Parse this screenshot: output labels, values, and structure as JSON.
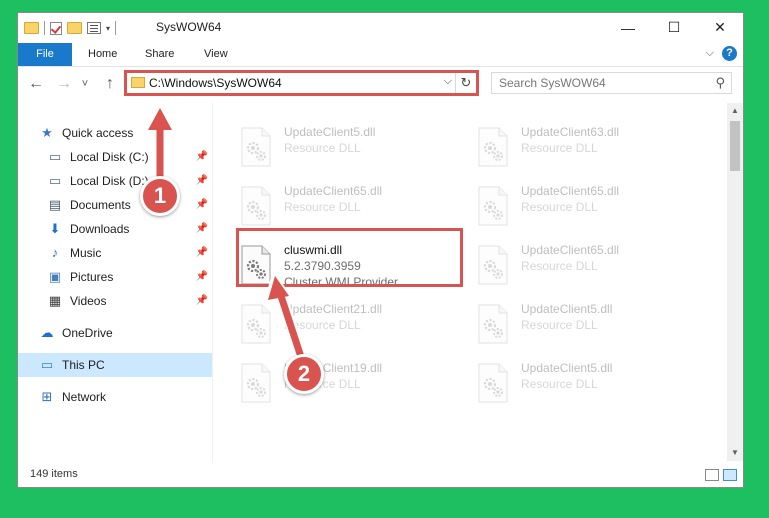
{
  "window": {
    "title": "SysWOW64",
    "controls": {
      "minimize": "—",
      "maximize": "☐",
      "close": "✕"
    }
  },
  "ribbon": {
    "tabs": [
      "File",
      "Home",
      "Share",
      "View"
    ],
    "expand_glyph": "⌵",
    "help_glyph": "?"
  },
  "nav": {
    "back_glyph": "←",
    "forward_glyph": "→",
    "recent_glyph": "˅",
    "up_glyph": "↑",
    "address": "C:\\Windows\\SysWOW64",
    "address_dropdown_glyph": "⌵",
    "refresh_glyph": "↻",
    "search_placeholder": "Search SysWOW64",
    "search_glyph": "⚲"
  },
  "sidebar": {
    "items": [
      {
        "label": "Quick access",
        "icon": "star-icon",
        "glyph": "★",
        "color": "#3a78c9",
        "pinned": false
      },
      {
        "label": "Local Disk (C:)",
        "icon": "drive-icon",
        "glyph": "▭",
        "color": "#5a6e80",
        "pinned": true
      },
      {
        "label": "Local Disk (D:)",
        "icon": "drive-icon",
        "glyph": "▭",
        "color": "#5a6e80",
        "pinned": true
      },
      {
        "label": "Documents",
        "icon": "document-icon",
        "glyph": "▤",
        "color": "#4a5a6a",
        "pinned": true
      },
      {
        "label": "Downloads",
        "icon": "download-icon",
        "glyph": "⬇",
        "color": "#1f6fcf",
        "pinned": true
      },
      {
        "label": "Music",
        "icon": "music-icon",
        "glyph": "♪",
        "color": "#2e6fd0",
        "pinned": true
      },
      {
        "label": "Pictures",
        "icon": "pictures-icon",
        "glyph": "▣",
        "color": "#4a7fb8",
        "pinned": true
      },
      {
        "label": "Videos",
        "icon": "video-icon",
        "glyph": "▦",
        "color": "#3a3a3a",
        "pinned": true
      },
      {
        "label": "OneDrive",
        "icon": "cloud-icon",
        "glyph": "☁",
        "color": "#1d6fd1",
        "pinned": false
      },
      {
        "label": "This PC",
        "icon": "computer-icon",
        "glyph": "▭",
        "color": "#2f88d8",
        "pinned": false,
        "selected": true
      },
      {
        "label": "Network",
        "icon": "network-icon",
        "glyph": "⊞",
        "color": "#2f6fb8",
        "pinned": false
      }
    ],
    "pin_glyph": "📌"
  },
  "files": [
    {
      "name": "UpdateClient5.dll",
      "sub1": "Resource DLL",
      "faded": true
    },
    {
      "name": "UpdateClient63.dll",
      "sub1": "Resource DLL",
      "faded": true
    },
    {
      "name": "UpdateClient65.dll",
      "sub1": "Resource DLL",
      "faded": true
    },
    {
      "name": "UpdateClient65.dll",
      "sub1": "Resource DLL",
      "faded": true
    },
    {
      "name": "cluswmi.dll",
      "sub1": "5.2.3790.3959",
      "sub2": "Cluster WMI Provider",
      "faded": false
    },
    {
      "name": "UpdateClient65.dll",
      "sub1": "Resource DLL",
      "faded": true
    },
    {
      "name": "UpdateClient21.dll",
      "sub1": "Resource DLL",
      "faded": true
    },
    {
      "name": "UpdateClient5.dll",
      "sub1": "Resource DLL",
      "faded": true
    },
    {
      "name": "UpdateClient19.dll",
      "sub1": "Resource DLL",
      "faded": true
    },
    {
      "name": "UpdateClient5.dll",
      "sub1": "Resource DLL",
      "faded": true
    }
  ],
  "status": {
    "item_count": "149 items"
  },
  "scroll": {
    "up_glyph": "▲",
    "down_glyph": "▼"
  },
  "annotations": [
    {
      "number": "1",
      "target": "address-bar"
    },
    {
      "number": "2",
      "target": "cluswmi-file"
    }
  ],
  "colors": {
    "accent": "#1979ca",
    "annotation": "#d9534f",
    "background": "#1dbf60",
    "selection": "#cce8ff"
  }
}
